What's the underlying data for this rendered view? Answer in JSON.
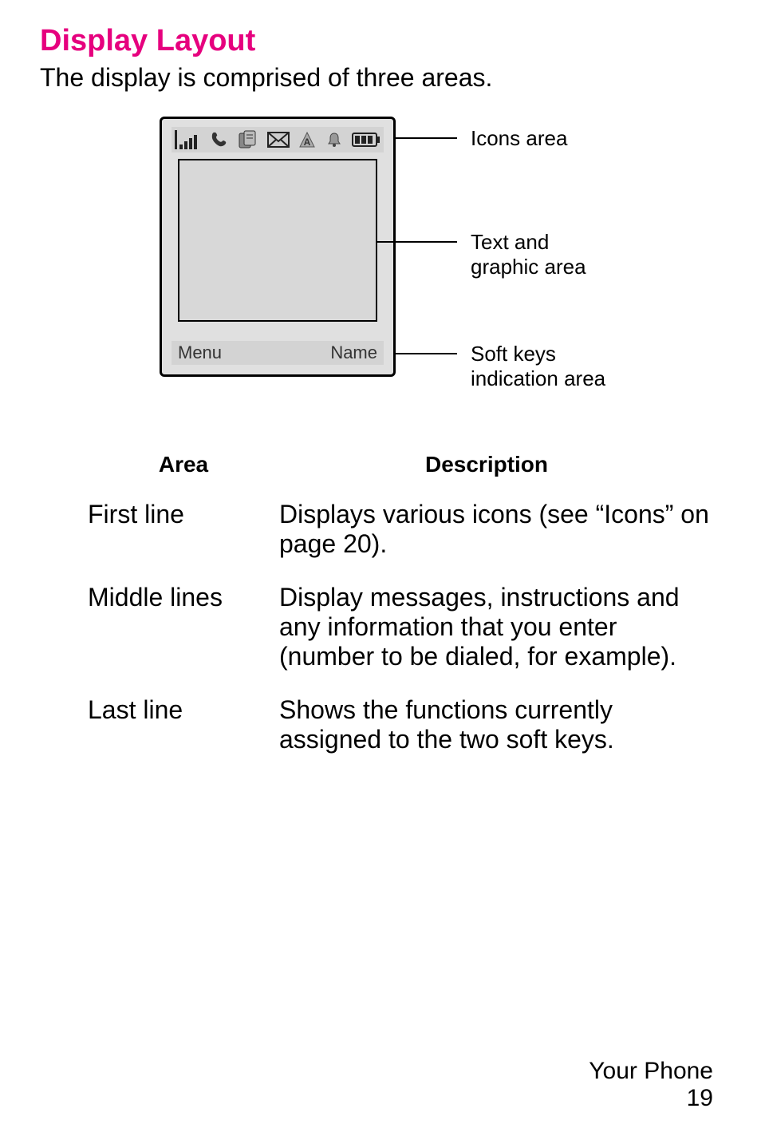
{
  "section_title": "Display Layout",
  "intro": "The display is comprised of three areas.",
  "diagram": {
    "softkey_left": "Menu",
    "softkey_right": "Name",
    "callout_icons": "Icons area",
    "callout_text_line1": "Text and",
    "callout_text_line2": "graphic area",
    "callout_soft_line1": "Soft keys",
    "callout_soft_line2": "indication area",
    "status_icons": [
      "signal-icon",
      "call-icon",
      "sheet-icon",
      "mail-icon",
      "a-icon",
      "bell-icon",
      "battery-icon"
    ]
  },
  "table": {
    "header_area": "Area",
    "header_desc": "Description",
    "rows": [
      {
        "area": "First line",
        "desc": "Displays various icons (see “Icons” on page 20)."
      },
      {
        "area": "Middle lines",
        "desc": "Display messages, instructions and any information that you enter (number to be dialed, for example)."
      },
      {
        "area": "Last line",
        "desc": "Shows the functions currently assigned to the two soft keys."
      }
    ]
  },
  "footer": {
    "label": "Your Phone",
    "page": "19"
  }
}
